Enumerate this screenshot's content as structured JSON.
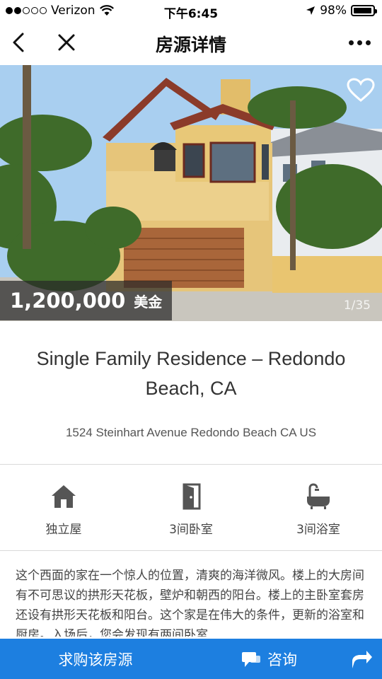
{
  "status_bar": {
    "carrier": "Verizon",
    "time": "下午6:45",
    "battery": "98%",
    "battery_level": 0.98
  },
  "nav": {
    "title": "房源详情"
  },
  "hero": {
    "price": "1,200,000",
    "currency": "美金",
    "photo_counter": "1/35"
  },
  "listing": {
    "title": "Single Family Residence – Redondo Beach, CA",
    "address": "1524 Steinhart Avenue Redondo Beach CA US"
  },
  "features": [
    {
      "icon": "house-icon",
      "label": "独立屋"
    },
    {
      "icon": "door-icon",
      "label": "3间卧室"
    },
    {
      "icon": "bathtub-icon",
      "label": "3间浴室"
    }
  ],
  "description": "这个西面的家在一个惊人的位置，清爽的海洋微风。楼上的大房间有不可思议的拱形天花板，壁炉和朝西的阳台。楼上的主卧室套房还设有拱形天花板和阳台。这个家是在伟大的条件，更新的浴室和厨房。入场后，您会发现有两间卧室",
  "bottom_bar": {
    "buy_label": "求购该房源",
    "consult_label": "咨询"
  },
  "colors": {
    "accent": "#1d7fe0"
  }
}
